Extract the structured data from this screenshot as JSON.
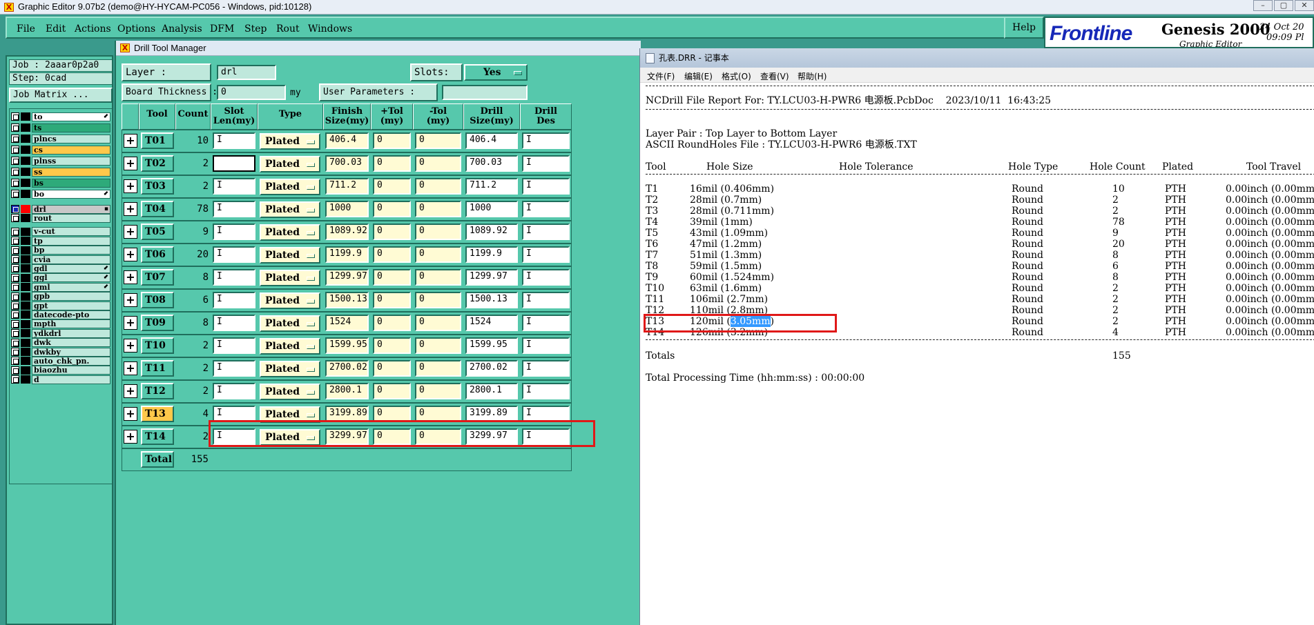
{
  "main_window": {
    "title": "Graphic Editor 9.07b2 (demo@HY-HYCAM-PC056 - Windows, pid:10128)",
    "window_buttons": [
      "–",
      "▢",
      "✕"
    ]
  },
  "menu": [
    "File",
    "Edit",
    "Actions",
    "Options",
    "Analysis",
    "DFM",
    "Step",
    "Rout",
    "Windows"
  ],
  "help_label": "Help",
  "logo": {
    "brand": "Frontline",
    "product": "Genesis 2000",
    "subtitle": "Graphic Editor",
    "date": "24 Oct 20",
    "time": "09:09 Pl"
  },
  "left_panel": {
    "job": "Job : 2aaar0p2a0",
    "step": "Step: 0cad",
    "job_matrix": "Job Matrix ...",
    "layers": [
      {
        "name": "to",
        "color": "#ffffff",
        "arrow": "⬋"
      },
      {
        "name": "ts",
        "color": "#2eaa7a",
        "arrow": ""
      },
      {
        "name": "plncs",
        "color": "#bfe8dc",
        "arrow": ""
      },
      {
        "name": "cs",
        "color": "#ffc84a",
        "arrow": ""
      },
      {
        "name": "plnss",
        "color": "#bfe8dc",
        "arrow": ""
      },
      {
        "name": "ss",
        "color": "#ffc84a",
        "arrow": ""
      },
      {
        "name": "bs",
        "color": "#2eaa7a",
        "arrow": ""
      },
      {
        "name": "bo",
        "color": "#ffffff",
        "arrow": "⬋"
      },
      {
        "name": "drl",
        "color": "#c8c8c8",
        "arrow": "▪"
      },
      {
        "name": "rout",
        "color": "#bfe8dc",
        "arrow": ""
      },
      {
        "name": "v-cut",
        "color": "#bfe8dc",
        "arrow": ""
      },
      {
        "name": "tp",
        "color": "#bfe8dc",
        "arrow": ""
      },
      {
        "name": "bp",
        "color": "#bfe8dc",
        "arrow": ""
      },
      {
        "name": "cvia",
        "color": "#bfe8dc",
        "arrow": ""
      },
      {
        "name": "gdl",
        "color": "#bfe8dc",
        "arrow": "⬋"
      },
      {
        "name": "ggl",
        "color": "#bfe8dc",
        "arrow": "⬋"
      },
      {
        "name": "gml",
        "color": "#bfe8dc",
        "arrow": "⬋"
      },
      {
        "name": "gpb",
        "color": "#bfe8dc",
        "arrow": ""
      },
      {
        "name": "gpt",
        "color": "#bfe8dc",
        "arrow": ""
      },
      {
        "name": "datecode-pto",
        "color": "#bfe8dc",
        "arrow": ""
      },
      {
        "name": "mpth",
        "color": "#bfe8dc",
        "arrow": ""
      },
      {
        "name": "ydkdrl",
        "color": "#bfe8dc",
        "arrow": ""
      },
      {
        "name": "dwk",
        "color": "#bfe8dc",
        "arrow": ""
      },
      {
        "name": "dwkby",
        "color": "#bfe8dc",
        "arrow": ""
      },
      {
        "name": "auto_chk_pn.",
        "color": "#bfe8dc",
        "arrow": ""
      },
      {
        "name": "biaozhu",
        "color": "#bfe8dc",
        "arrow": ""
      },
      {
        "name": "d",
        "color": "#bfe8dc",
        "arrow": ""
      }
    ]
  },
  "dtm": {
    "title": "Drill Tool Manager",
    "layer_label": "Layer          :",
    "layer_value": "drl",
    "slots_label": "Slots:",
    "slots_value": "Yes",
    "board_thickness_label": "Board Thickness :",
    "board_thickness_value": "0",
    "unit": "my",
    "user_params_label": "User Parameters :",
    "user_params_value": "",
    "headers": [
      "Tool",
      "Count",
      "Slot\nLen(my)",
      "Type",
      "Finish\nSize(my)",
      "+Tol\n(my)",
      "-Tol\n(my)",
      "Drill\nSize(my)",
      "Drill\nDes"
    ],
    "rows": [
      {
        "tool": "T01",
        "count": "10",
        "type": "Plated",
        "finish": "406.4",
        "ptol": "0",
        "mtol": "0",
        "drill": "406.4"
      },
      {
        "tool": "T02",
        "count": "2",
        "type": "Plated",
        "finish": "700.03",
        "ptol": "0",
        "mtol": "0",
        "drill": "700.03"
      },
      {
        "tool": "T03",
        "count": "2",
        "type": "Plated",
        "finish": "711.2",
        "ptol": "0",
        "mtol": "0",
        "drill": "711.2"
      },
      {
        "tool": "T04",
        "count": "78",
        "type": "Plated",
        "finish": "1000",
        "ptol": "0",
        "mtol": "0",
        "drill": "1000"
      },
      {
        "tool": "T05",
        "count": "9",
        "type": "Plated",
        "finish": "1089.92",
        "ptol": "0",
        "mtol": "0",
        "drill": "1089.92"
      },
      {
        "tool": "T06",
        "count": "20",
        "type": "Plated",
        "finish": "1199.9",
        "ptol": "0",
        "mtol": "0",
        "drill": "1199.9"
      },
      {
        "tool": "T07",
        "count": "8",
        "type": "Plated",
        "finish": "1299.97",
        "ptol": "0",
        "mtol": "0",
        "drill": "1299.97"
      },
      {
        "tool": "T08",
        "count": "6",
        "type": "Plated",
        "finish": "1500.13",
        "ptol": "0",
        "mtol": "0",
        "drill": "1500.13"
      },
      {
        "tool": "T09",
        "count": "8",
        "type": "Plated",
        "finish": "1524",
        "ptol": "0",
        "mtol": "0",
        "drill": "1524"
      },
      {
        "tool": "T10",
        "count": "2",
        "type": "Plated",
        "finish": "1599.95",
        "ptol": "0",
        "mtol": "0",
        "drill": "1599.95"
      },
      {
        "tool": "T11",
        "count": "2",
        "type": "Plated",
        "finish": "2700.02",
        "ptol": "0",
        "mtol": "0",
        "drill": "2700.02"
      },
      {
        "tool": "T12",
        "count": "2",
        "type": "Plated",
        "finish": "2800.1",
        "ptol": "0",
        "mtol": "0",
        "drill": "2800.1"
      },
      {
        "tool": "T13",
        "count": "4",
        "type": "Plated",
        "finish": "3199.89",
        "ptol": "0",
        "mtol": "0",
        "drill": "3199.89"
      },
      {
        "tool": "T14",
        "count": "2",
        "type": "Plated",
        "finish": "3299.97",
        "ptol": "0",
        "mtol": "0",
        "drill": "3299.97"
      }
    ],
    "total_label": "Total",
    "total_value": "155"
  },
  "notepad": {
    "title": "孔表.DRR - 记事本",
    "menu": [
      "文件(F)",
      "编辑(E)",
      "格式(O)",
      "查看(V)",
      "帮助(H)"
    ],
    "report_title": "NCDrill File Report For: TY.LCU03-H-PWR6 电源板.PcbDoc    2023/10/11  16:43:25",
    "layer_pair": "Layer Pair : Top Layer to Bottom Layer",
    "ascii_file": "ASCII RoundHoles File : TY.LCU03-H-PWR6 电源板.TXT",
    "columns": [
      "Tool",
      "Hole Size",
      "Hole Tolerance",
      "Hole Type",
      "Hole Count",
      "Plated",
      "Tool Travel"
    ],
    "rows": [
      {
        "tool": "T1",
        "size": "16mil (0.406mm)",
        "type": "Round",
        "count": "10",
        "plated": "PTH",
        "travel": "0.00inch (0.00mm"
      },
      {
        "tool": "T2",
        "size": "28mil (0.7mm)",
        "type": "Round",
        "count": "2",
        "plated": "PTH",
        "travel": "0.00inch (0.00mm"
      },
      {
        "tool": "T3",
        "size": "28mil (0.711mm)",
        "type": "Round",
        "count": "2",
        "plated": "PTH",
        "travel": "0.00inch (0.00mm"
      },
      {
        "tool": "T4",
        "size": "39mil (1mm)",
        "type": "Round",
        "count": "78",
        "plated": "PTH",
        "travel": "0.00inch (0.00mm"
      },
      {
        "tool": "T5",
        "size": "43mil (1.09mm)",
        "type": "Round",
        "count": "9",
        "plated": "PTH",
        "travel": "0.00inch (0.00mm"
      },
      {
        "tool": "T6",
        "size": "47mil (1.2mm)",
        "type": "Round",
        "count": "20",
        "plated": "PTH",
        "travel": "0.00inch (0.00mm"
      },
      {
        "tool": "T7",
        "size": "51mil (1.3mm)",
        "type": "Round",
        "count": "8",
        "plated": "PTH",
        "travel": "0.00inch (0.00mm"
      },
      {
        "tool": "T8",
        "size": "59mil (1.5mm)",
        "type": "Round",
        "count": "6",
        "plated": "PTH",
        "travel": "0.00inch (0.00mm"
      },
      {
        "tool": "T9",
        "size": "60mil (1.524mm)",
        "type": "Round",
        "count": "8",
        "plated": "PTH",
        "travel": "0.00inch (0.00mm"
      },
      {
        "tool": "T10",
        "size": "63mil (1.6mm)",
        "type": "Round",
        "count": "2",
        "plated": "PTH",
        "travel": "0.00inch (0.00mm"
      },
      {
        "tool": "T11",
        "size": "106mil (2.7mm)",
        "type": "Round",
        "count": "2",
        "plated": "PTH",
        "travel": "0.00inch (0.00mm"
      },
      {
        "tool": "T12",
        "size": "110mil (2.8mm)",
        "type": "Round",
        "count": "2",
        "plated": "PTH",
        "travel": "0.00inch (0.00mm"
      },
      {
        "tool": "T13",
        "size_pre": "120mil (",
        "size_sel": "3.05mm",
        "size_post": ")",
        "type": "Round",
        "count": "2",
        "plated": "PTH",
        "travel": "0.00inch (0.00mm"
      },
      {
        "tool": "T14",
        "size": "126mil (3.2mm)",
        "type": "Round",
        "count": "4",
        "plated": "PTH",
        "travel": "0.00inch (0.00mm"
      }
    ],
    "totals_label": "Totals",
    "totals_value": "155",
    "processing": "Total Processing Time (hh:mm:ss) : 00:00:00"
  }
}
